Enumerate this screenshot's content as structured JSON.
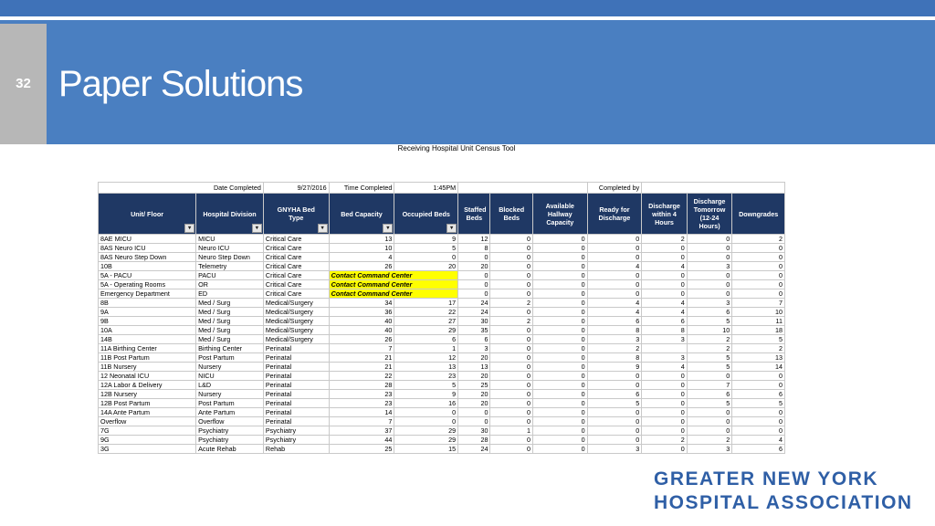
{
  "slide": {
    "number": "32",
    "title": "Paper Solutions"
  },
  "tool_title": "Receiving Hospital Unit Census Tool",
  "meta": {
    "date_label": "Date Completed",
    "date_value": "9/27/2016",
    "time_label": "Time Completed",
    "time_value": "1:45PM",
    "completed_by_label": "Completed by"
  },
  "columns": [
    "Unit/ Floor",
    "Hospital Division",
    "GNYHA Bed Type",
    "Bed Capacity",
    "Occupied Beds",
    "Staffed Beds",
    "Blocked Beds",
    "Available Hallway Capacity",
    "Ready for Discharge",
    "Discharge within 4 Hours",
    "Discharge Tomorrow (12-24 Hours)",
    "Downgrades"
  ],
  "filter_icon": "dropdown-arrow",
  "rows": [
    [
      "8AE MICU",
      "MICU",
      "Critical Care",
      "13",
      "9",
      "12",
      "0",
      "0",
      "0",
      "2",
      "0",
      "2"
    ],
    [
      "8AS Neuro ICU",
      "Neuro ICU",
      "Critical Care",
      "10",
      "5",
      "8",
      "0",
      "0",
      "0",
      "0",
      "0",
      "0"
    ],
    [
      "8AS Neuro Step Down",
      "Neuro Step Down",
      "Critical Care",
      "4",
      "0",
      "0",
      "0",
      "0",
      "0",
      "0",
      "0",
      "0"
    ],
    [
      "10B",
      "Telemetry",
      "Critical Care",
      "26",
      "20",
      "20",
      "0",
      "0",
      "4",
      "4",
      "3",
      "0"
    ],
    [
      "5A - PACU",
      "PACU",
      "Critical Care",
      "Contact Command Center",
      "",
      "0",
      "0",
      "0",
      "0",
      "0",
      "0",
      "0"
    ],
    [
      "5A - Operating Rooms",
      "OR",
      "Critical Care",
      "Contact Command Center",
      "",
      "0",
      "0",
      "0",
      "0",
      "0",
      "0",
      "0"
    ],
    [
      "Emergency Department",
      "ED",
      "Critical Care",
      "Contact Command Center",
      "",
      "0",
      "0",
      "0",
      "0",
      "0",
      "0",
      "0"
    ],
    [
      "8B",
      "Med / Surg",
      "Medical/Surgery",
      "34",
      "17",
      "24",
      "2",
      "0",
      "4",
      "4",
      "3",
      "7"
    ],
    [
      "9A",
      "Med / Surg",
      "Medical/Surgery",
      "36",
      "22",
      "24",
      "0",
      "0",
      "4",
      "4",
      "6",
      "10"
    ],
    [
      "9B",
      "Med / Surg",
      "Medical/Surgery",
      "40",
      "27",
      "30",
      "2",
      "0",
      "6",
      "6",
      "5",
      "11"
    ],
    [
      "10A",
      "Med / Surg",
      "Medical/Surgery",
      "40",
      "29",
      "35",
      "0",
      "0",
      "8",
      "8",
      "10",
      "18"
    ],
    [
      "14B",
      "Med / Surg",
      "Medical/Surgery",
      "26",
      "6",
      "6",
      "0",
      "0",
      "3",
      "3",
      "2",
      "5"
    ],
    [
      "11A Birthing Center",
      "Birthing Center",
      "Perinatal",
      "7",
      "1",
      "3",
      "0",
      "0",
      "2",
      "",
      "2",
      "2"
    ],
    [
      "11B Post Partum",
      "Post Partum",
      "Perinatal",
      "21",
      "12",
      "20",
      "0",
      "0",
      "8",
      "3",
      "5",
      "13"
    ],
    [
      "11B Nursery",
      "Nursery",
      "Perinatal",
      "21",
      "13",
      "13",
      "0",
      "0",
      "9",
      "4",
      "5",
      "14"
    ],
    [
      "12 Neonatal ICU",
      "NICU",
      "Perinatal",
      "22",
      "23",
      "20",
      "0",
      "0",
      "0",
      "0",
      "0",
      "0"
    ],
    [
      "12A Labor & Delivery",
      "L&D",
      "Perinatal",
      "28",
      "5",
      "25",
      "0",
      "0",
      "0",
      "0",
      "7",
      "0"
    ],
    [
      "12B Nursery",
      "Nursery",
      "Perinatal",
      "23",
      "9",
      "20",
      "0",
      "0",
      "6",
      "0",
      "6",
      "6"
    ],
    [
      "12B Post Partum",
      "Post Partum",
      "Perinatal",
      "23",
      "16",
      "20",
      "0",
      "0",
      "5",
      "0",
      "5",
      "5"
    ],
    [
      "14A Ante Partum",
      "Ante Partum",
      "Perinatal",
      "14",
      "0",
      "0",
      "0",
      "0",
      "0",
      "0",
      "0",
      "0"
    ],
    [
      "Overflow",
      "Overflow",
      "Perinatal",
      "7",
      "0",
      "0",
      "0",
      "0",
      "0",
      "0",
      "0",
      "0"
    ],
    [
      "7G",
      "Psychiatry",
      "Psychiatry",
      "37",
      "29",
      "30",
      "1",
      "0",
      "0",
      "0",
      "0",
      "0"
    ],
    [
      "9G",
      "Psychiatry",
      "Psychiatry",
      "44",
      "29",
      "28",
      "0",
      "0",
      "0",
      "2",
      "2",
      "4"
    ],
    [
      "3G",
      "Acute Rehab",
      "Rehab",
      "25",
      "15",
      "24",
      "0",
      "0",
      "3",
      "0",
      "3",
      "6"
    ]
  ],
  "logo": {
    "line1": "GREATER NEW YORK",
    "line2": "HOSPITAL ASSOCIATION"
  },
  "colors": {
    "banner": "#4a7fc1",
    "header": "#1f3864",
    "highlight": "#ffff00",
    "logo": "#2f5fa6"
  }
}
